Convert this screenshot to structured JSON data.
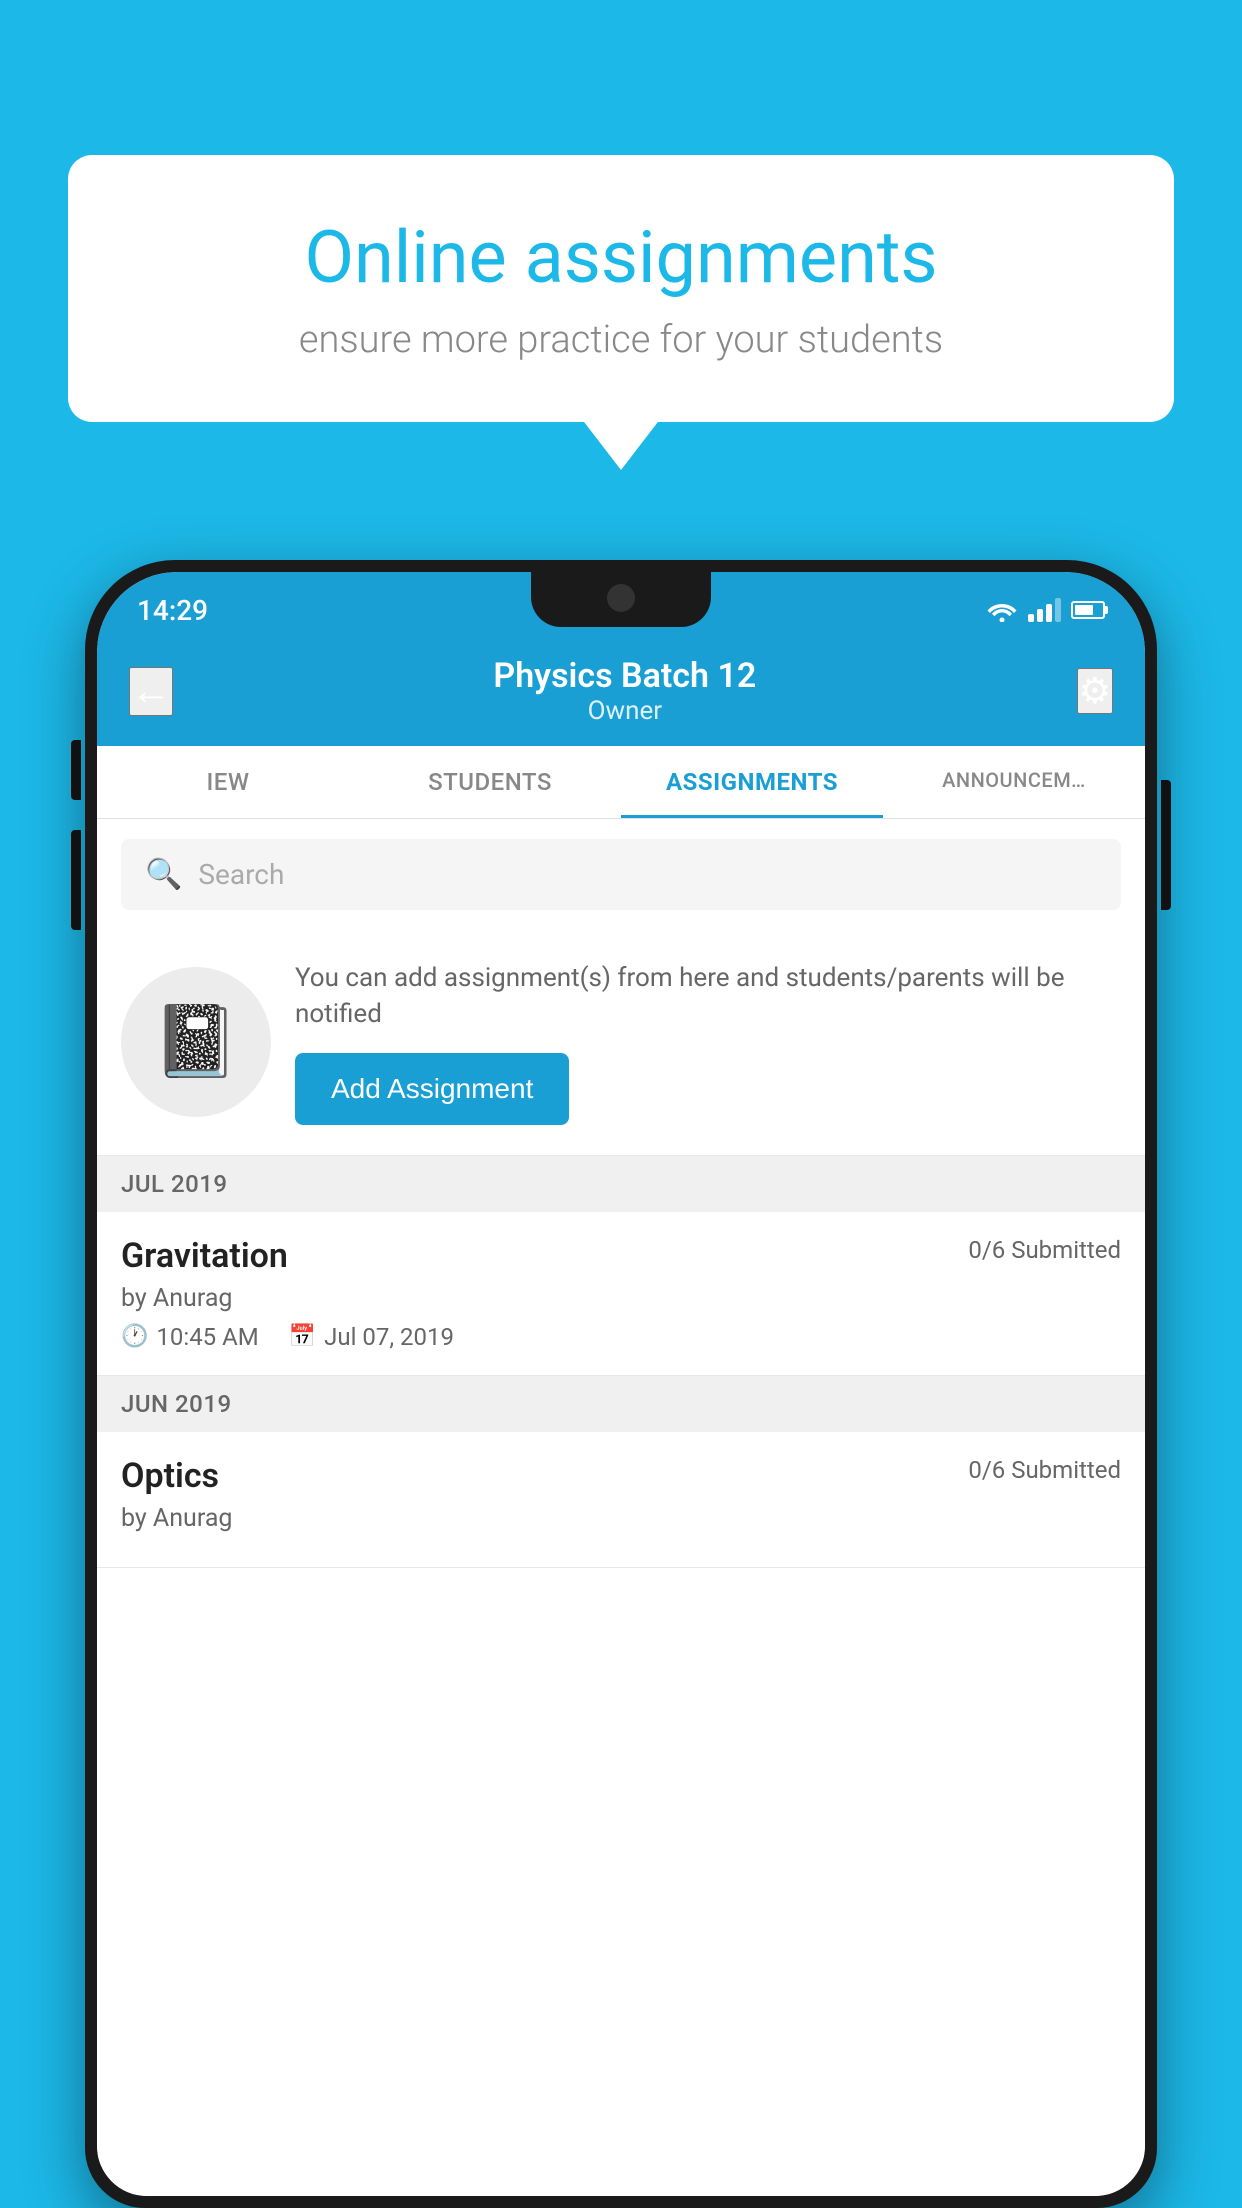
{
  "background": {
    "color": "#1cb8e8"
  },
  "speech_bubble": {
    "title": "Online assignments",
    "subtitle": "ensure more practice for your students"
  },
  "status_bar": {
    "time": "14:29"
  },
  "top_bar": {
    "title": "Physics Batch 12",
    "subtitle": "Owner",
    "back_label": "←",
    "settings_label": "⚙"
  },
  "tabs": [
    {
      "label": "IEW",
      "active": false
    },
    {
      "label": "STUDENTS",
      "active": false
    },
    {
      "label": "ASSIGNMENTS",
      "active": true
    },
    {
      "label": "ANNOUNCEM…",
      "active": false
    }
  ],
  "search": {
    "placeholder": "Search"
  },
  "promo": {
    "text": "You can add assignment(s) from here and students/parents will be notified",
    "button_label": "Add Assignment"
  },
  "sections": [
    {
      "header": "JUL 2019",
      "assignments": [
        {
          "name": "Gravitation",
          "submitted": "0/6 Submitted",
          "by": "by Anurag",
          "time": "10:45 AM",
          "date": "Jul 07, 2019"
        }
      ]
    },
    {
      "header": "JUN 2019",
      "assignments": [
        {
          "name": "Optics",
          "submitted": "0/6 Submitted",
          "by": "by Anurag",
          "time": "",
          "date": ""
        }
      ]
    }
  ]
}
